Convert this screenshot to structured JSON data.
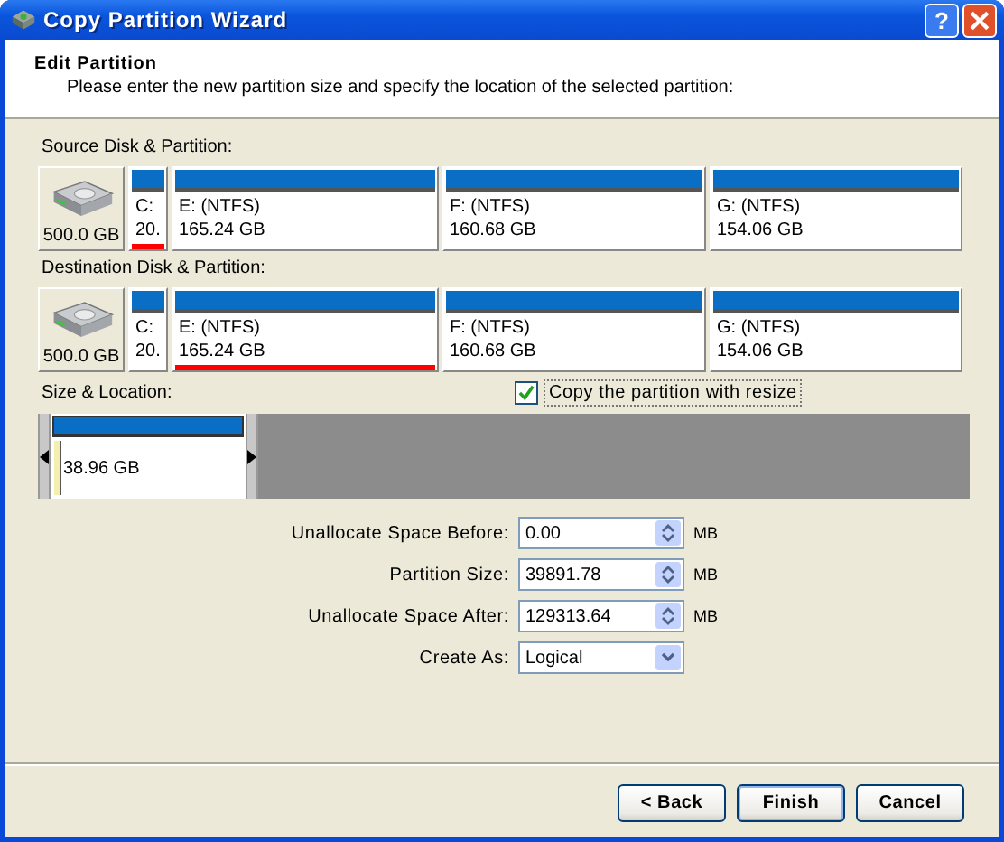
{
  "window": {
    "title": "Copy Partition Wizard",
    "help_glyph": "?"
  },
  "header": {
    "title": "Edit Partition",
    "description": "Please enter the new partition size and specify the location of the selected partition:"
  },
  "source": {
    "label": "Source Disk & Partition:",
    "disk_size": "500.0 GB",
    "partitions": [
      {
        "name": "C:",
        "size": "20.",
        "selected": true
      },
      {
        "name": "E: (NTFS)",
        "size": "165.24 GB",
        "selected": false
      },
      {
        "name": "F: (NTFS)",
        "size": "160.68 GB",
        "selected": false
      },
      {
        "name": "G: (NTFS)",
        "size": "154.06 GB",
        "selected": false
      }
    ]
  },
  "destination": {
    "label": "Destination Disk & Partition:",
    "disk_size": "500.0 GB",
    "partitions": [
      {
        "name": "C:",
        "size": "20.",
        "selected": false
      },
      {
        "name": "E: (NTFS)",
        "size": "165.24 GB",
        "selected": true
      },
      {
        "name": "F: (NTFS)",
        "size": "160.68 GB",
        "selected": false
      },
      {
        "name": "G: (NTFS)",
        "size": "154.06 GB",
        "selected": false
      }
    ]
  },
  "size_location": {
    "label": "Size & Location:",
    "resize_checkbox": {
      "label": "Copy the partition with resize",
      "checked": true
    },
    "partition_size": "38.96 GB"
  },
  "fields": [
    {
      "label": "Unallocate Space Before:",
      "value": "0.00",
      "kind": "spin",
      "unit": "MB"
    },
    {
      "label": "Partition Size:",
      "value": "39891.78",
      "kind": "spin",
      "unit": "MB"
    },
    {
      "label": "Unallocate Space After:",
      "value": "129313.64",
      "kind": "spin",
      "unit": "MB"
    },
    {
      "label": "Create As:",
      "value": "Logical",
      "kind": "dropdown"
    }
  ],
  "buttons": [
    {
      "label": "< Back"
    },
    {
      "label": "Finish"
    },
    {
      "label": "Cancel"
    }
  ]
}
